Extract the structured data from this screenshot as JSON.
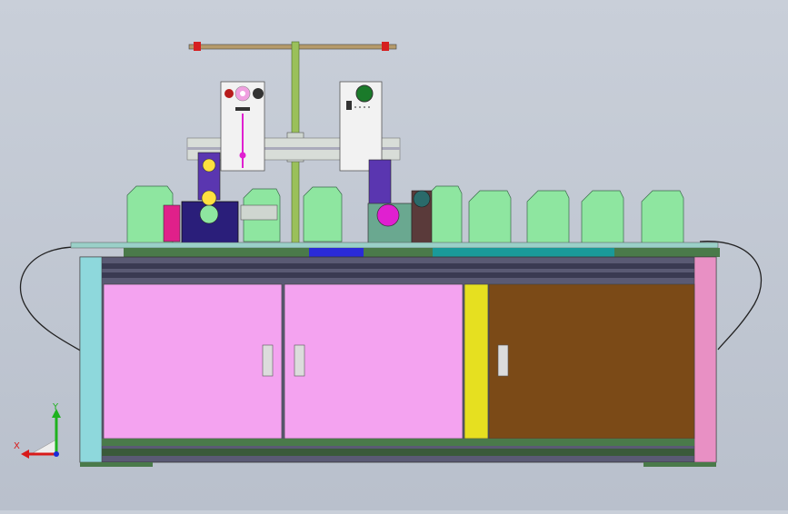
{
  "viewport": {
    "background": "#c3c9d4",
    "view_type": "CAD front view"
  },
  "triad": {
    "x_label": "X",
    "y_label": "Y",
    "x_color": "#d81a1a",
    "y_color": "#1fb21f",
    "z_color": "#1a2ad8"
  },
  "colors": {
    "door_pink": "#f4a3f0",
    "door_brown": "#7b4a17",
    "frame_dark": "#5a5a74",
    "frame_green": "#4a7a4a",
    "fixture_green": "#8ee6a0",
    "post_cyan": "#8ed8dc",
    "post_pink": "#e890c4",
    "strip_yellow": "#e6e020",
    "motor_purple": "#5a36b0",
    "panel_white": "#f2f2f2",
    "magenta": "#e020d0"
  }
}
